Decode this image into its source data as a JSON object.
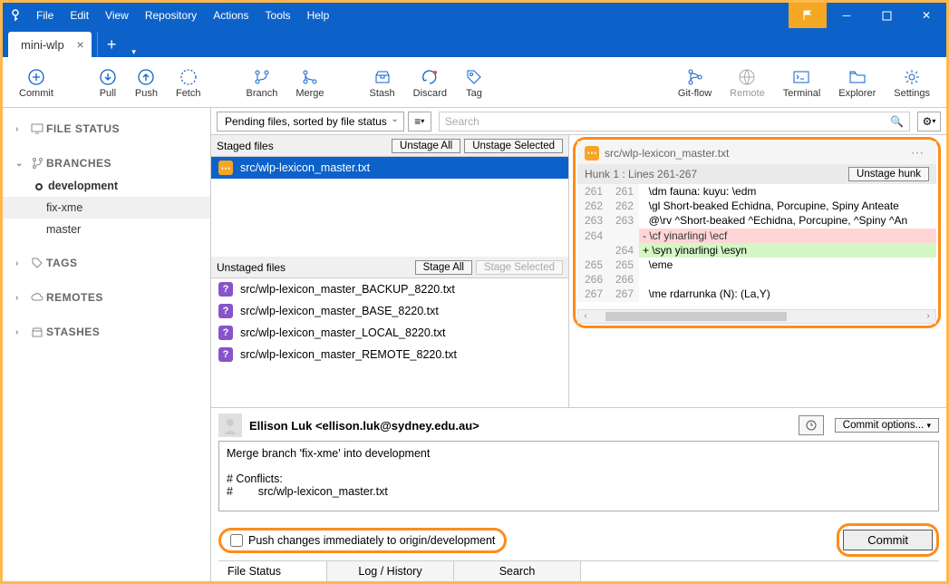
{
  "menu": [
    "File",
    "Edit",
    "View",
    "Repository",
    "Actions",
    "Tools",
    "Help"
  ],
  "tab_name": "mini-wlp",
  "toolbar": {
    "commit": "Commit",
    "pull": "Pull",
    "push": "Push",
    "fetch": "Fetch",
    "branch": "Branch",
    "merge": "Merge",
    "stash": "Stash",
    "discard": "Discard",
    "tag": "Tag",
    "gitflow": "Git-flow",
    "remote": "Remote",
    "terminal": "Terminal",
    "explorer": "Explorer",
    "settings": "Settings"
  },
  "sidebar": {
    "file_status": "FILE STATUS",
    "branches": "BRANCHES",
    "branch_items": [
      "development",
      "fix-xme",
      "master"
    ],
    "tags": "TAGS",
    "remotes": "REMOTES",
    "stashes": "STASHES"
  },
  "filter_label": "Pending files, sorted by file status",
  "search_placeholder": "Search",
  "staged": {
    "title": "Staged files",
    "unstage_all": "Unstage All",
    "unstage_selected": "Unstage Selected",
    "files": [
      "src/wlp-lexicon_master.txt"
    ]
  },
  "unstaged": {
    "title": "Unstaged files",
    "stage_all": "Stage All",
    "stage_selected": "Stage Selected",
    "files": [
      "src/wlp-lexicon_master_BACKUP_8220.txt",
      "src/wlp-lexicon_master_BASE_8220.txt",
      "src/wlp-lexicon_master_LOCAL_8220.txt",
      "src/wlp-lexicon_master_REMOTE_8220.txt"
    ]
  },
  "diff": {
    "filename": "src/wlp-lexicon_master.txt",
    "hunk_label": "Hunk 1 : Lines 261-267",
    "unstage_hunk": "Unstage hunk",
    "lines": [
      {
        "a": "261",
        "b": "261",
        "t": "ctx",
        "c": "  \\dm fauna: kuyu: \\edm"
      },
      {
        "a": "262",
        "b": "262",
        "t": "ctx",
        "c": "  \\gl Short-beaked Echidna, Porcupine, Spiny Anteate"
      },
      {
        "a": "263",
        "b": "263",
        "t": "ctx",
        "c": "  @\\rv ^Short-beaked ^Echidna, Porcupine, ^Spiny ^An"
      },
      {
        "a": "264",
        "b": "",
        "t": "del",
        "c": "- \\cf yinarlingi \\ecf"
      },
      {
        "a": "",
        "b": "264",
        "t": "add",
        "c": "+ \\syn yinarlingi \\esyn"
      },
      {
        "a": "265",
        "b": "265",
        "t": "ctx",
        "c": "  \\eme"
      },
      {
        "a": "266",
        "b": "266",
        "t": "ctx",
        "c": ""
      },
      {
        "a": "267",
        "b": "267",
        "t": "ctx",
        "c": "  \\me rdarrunka (N): (La,Y)"
      }
    ]
  },
  "commit": {
    "author": "Ellison Luk <ellison.luk@sydney.edu.au>",
    "options": "Commit options...",
    "message": "Merge branch 'fix-xme' into development\n\n# Conflicts:\n#        src/wlp-lexicon_master.txt",
    "push_immediate": "Push changes immediately to origin/development",
    "commit_btn": "Commit"
  },
  "bottom_tabs": [
    "File Status",
    "Log / History",
    "Search"
  ]
}
